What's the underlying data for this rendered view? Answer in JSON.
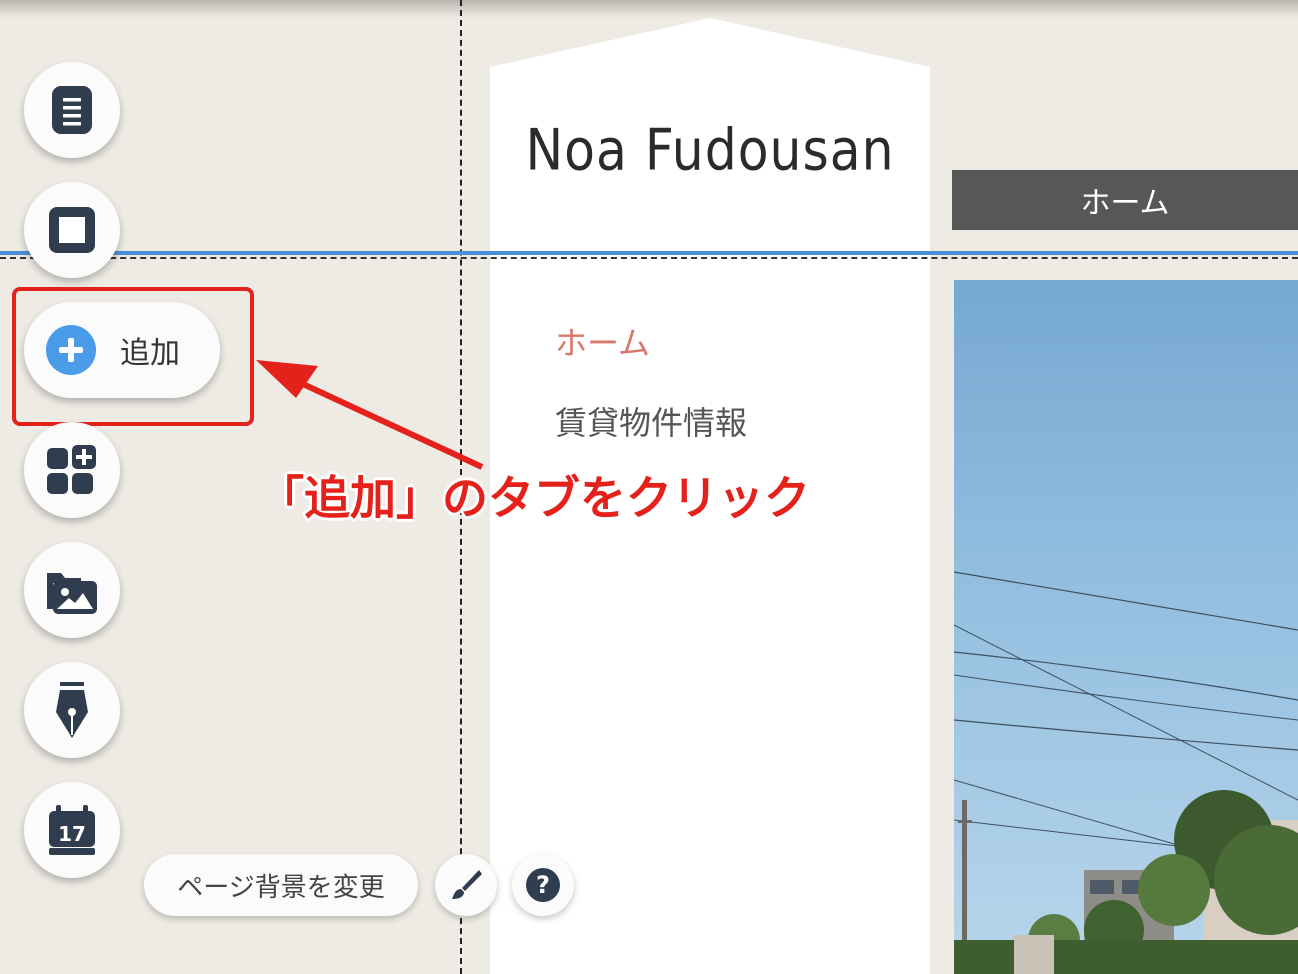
{
  "toolbar": {
    "add_label": "追加",
    "calendar_day": "17"
  },
  "bottom": {
    "change_background_label": "ページ背景を変更"
  },
  "site": {
    "logo": "Noa Fudousan",
    "top_nav_home": "ホーム",
    "menu": [
      {
        "label": "ホーム",
        "active": true
      },
      {
        "label": "賃貸物件情報",
        "active": false
      }
    ]
  },
  "annotation": {
    "text": "「追加」のタブをクリック",
    "color": "#e5211b"
  },
  "colors": {
    "accent_blue": "#4a9be8",
    "nav_active": "#d9776b",
    "icon_dark": "#2f3d4f"
  }
}
